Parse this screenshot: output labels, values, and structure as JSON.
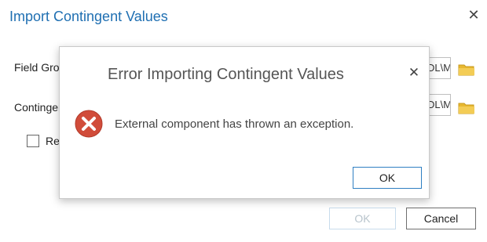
{
  "main": {
    "title": "Import Contingent Values",
    "field_groups_label": "Field Groups",
    "contingent_label": "Contingent Values",
    "field_groups_path": "DL\\M",
    "contingent_path": "DL\\M",
    "checkbox_label": "Replace",
    "checkbox_checked": false,
    "ok_label": "OK",
    "cancel_label": "Cancel"
  },
  "error": {
    "title": "Error Importing Contingent Values",
    "message": "External component has thrown an exception.",
    "ok_label": "OK",
    "icon": "error-icon"
  },
  "colors": {
    "title_blue": "#1f6fb2",
    "error_red": "#d14c3a",
    "folder_yellow": "#e8b830",
    "button_border_blue": "#2f7fc2"
  }
}
